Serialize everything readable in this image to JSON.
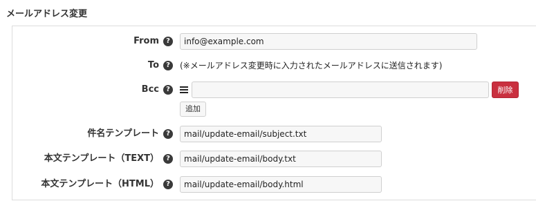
{
  "section": {
    "title": "メールアドレス変更"
  },
  "fields": {
    "from": {
      "label": "From",
      "value": "info@example.com"
    },
    "to": {
      "label": "To",
      "note": "(※メールアドレス変更時に入力されたメールアドレスに送信されます)"
    },
    "bcc": {
      "label": "Bcc",
      "value": "",
      "delete_label": "削除",
      "add_label": "追加"
    },
    "subject_template": {
      "label": "件名テンプレート",
      "value": "mail/update-email/subject.txt"
    },
    "body_text_template": {
      "label": "本文テンプレート（TEXT）",
      "value": "mail/update-email/body.txt"
    },
    "body_html_template": {
      "label": "本文テンプレート（HTML）",
      "value": "mail/update-email/body.html"
    }
  },
  "icons": {
    "help": "question-circle-icon",
    "drag": "drag-handle-icon"
  },
  "colors": {
    "danger": "#c9303f",
    "input_bg": "#f7f7f7"
  }
}
